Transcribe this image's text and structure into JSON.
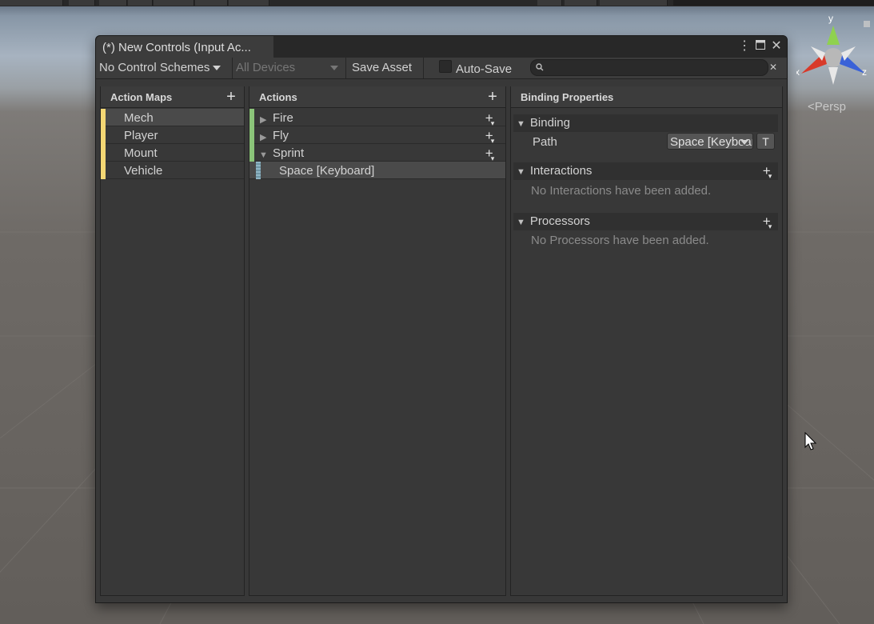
{
  "scene": {
    "persp_label": "Persp",
    "gizmo_axes": {
      "x": "x",
      "y": "y",
      "z": "z"
    }
  },
  "window": {
    "tab_title": "(*) New Controls (Input Ac...",
    "colors": {
      "map_stripe": "#f4d774",
      "action_stripe": "#8bc479",
      "binding_stripe": "#8fb5c4"
    }
  },
  "toolbar": {
    "control_schemes": "No Control Schemes",
    "devices": "All Devices",
    "save_asset": "Save Asset",
    "auto_save": "Auto-Save",
    "search_placeholder": ""
  },
  "action_maps": {
    "header": "Action Maps",
    "items": [
      {
        "label": "Mech",
        "selected": true
      },
      {
        "label": "Player",
        "selected": false
      },
      {
        "label": "Mount",
        "selected": false
      },
      {
        "label": "Vehicle",
        "selected": false
      }
    ]
  },
  "actions": {
    "header": "Actions",
    "items": [
      {
        "label": "Fire",
        "expanded": false
      },
      {
        "label": "Fly",
        "expanded": false
      },
      {
        "label": "Sprint",
        "expanded": true
      }
    ],
    "bindings": [
      {
        "label": "Space [Keyboard]",
        "selected": true
      }
    ]
  },
  "binding_properties": {
    "header": "Binding Properties",
    "binding_section": "Binding",
    "path_label": "Path",
    "path_value": "Space [Keyboard]",
    "t_button": "T",
    "interactions_section": "Interactions",
    "interactions_empty": "No Interactions have been added.",
    "processors_section": "Processors",
    "processors_empty": "No Processors have been added."
  }
}
